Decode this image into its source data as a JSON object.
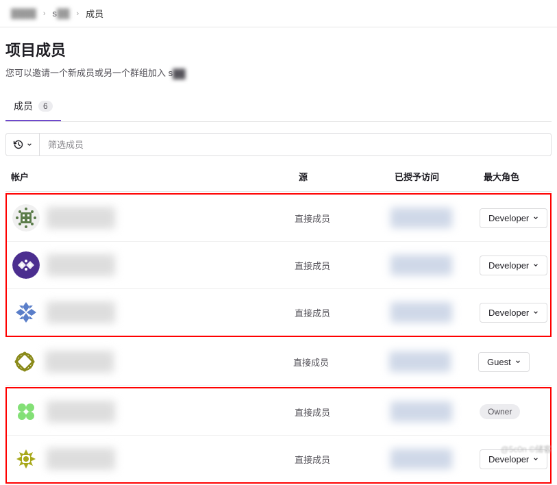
{
  "breadcrumb": {
    "item1_blur": "████",
    "item2": "s",
    "item2_blur": "██",
    "item3": "成员"
  },
  "header": {
    "title": "项目成员",
    "subtitle_prefix": "您可以邀请一个新成员或另一个群组加入 s",
    "subtitle_blur": "██"
  },
  "tabs": {
    "members_label": "成员",
    "members_count": "6"
  },
  "filter": {
    "placeholder": "筛选成员"
  },
  "columns": {
    "account": "帐户",
    "source": "源",
    "access": "已授予访问",
    "max_role": "最大角色"
  },
  "roles": {
    "developer": "Developer",
    "guest": "Guest",
    "owner": "Owner"
  },
  "source_labels": {
    "direct": "直接成员"
  },
  "members": [
    {
      "avatar_bg": "#5b7c4a",
      "avatar_type": "identicon1",
      "source": "直接成员",
      "role": "Developer",
      "role_type": "select",
      "highlight_group": 1
    },
    {
      "avatar_bg": "#4b2e8f",
      "avatar_type": "identicon2",
      "source": "直接成员",
      "role": "Developer",
      "role_type": "select",
      "highlight_group": 1
    },
    {
      "avatar_bg": "#5a7ec9",
      "avatar_type": "identicon3",
      "source": "直接成员",
      "role": "Developer",
      "role_type": "select",
      "highlight_group": 1
    },
    {
      "avatar_bg": "#8a8a1a",
      "avatar_type": "identicon4",
      "source": "直接成员",
      "role": "Guest",
      "role_type": "select",
      "highlight_group": 0
    },
    {
      "avatar_bg": "#6ddb5e",
      "avatar_type": "identicon5",
      "source": "直接成员",
      "role": "Owner",
      "role_type": "badge",
      "highlight_group": 2
    },
    {
      "avatar_bg": "#a8a81a",
      "avatar_type": "identicon6",
      "source": "直接成员",
      "role": "Developer",
      "role_type": "select",
      "highlight_group": 2
    }
  ],
  "watermark": "@5c0n ©储客"
}
